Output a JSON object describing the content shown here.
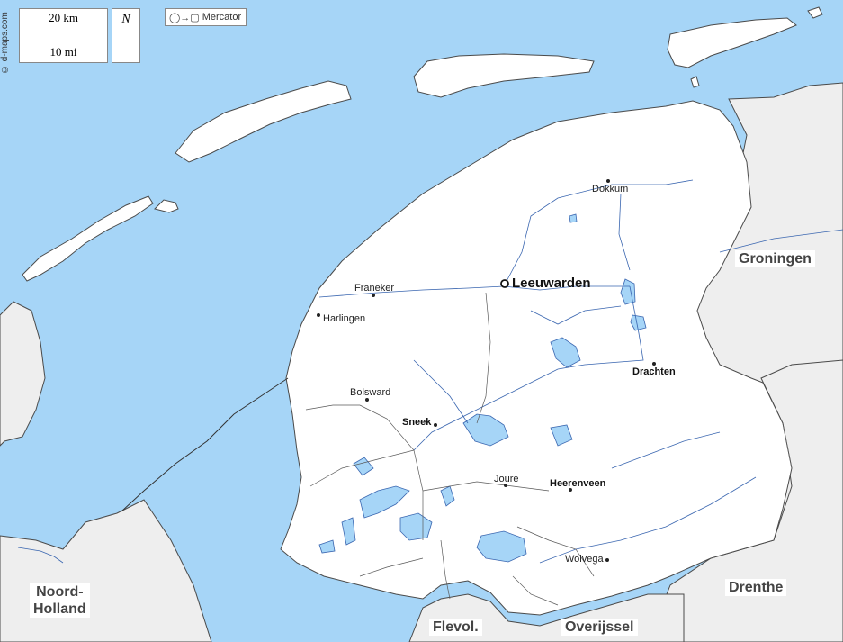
{
  "map": {
    "credit": "© d-maps.com",
    "projection": "Mercator",
    "projection_symbol": "◯→▢",
    "north": "N",
    "scale": {
      "km": "20 km",
      "mi": "10 mi"
    },
    "colors": {
      "water": "#a6d5f7",
      "land": "#ffffff",
      "neighbor": "#eeeeee",
      "border": "#4a4a4a",
      "river": "#3a66b0"
    },
    "capital": {
      "name": "Leeuwarden",
      "icon": "capital-circle-icon"
    },
    "cities": [
      {
        "id": "dokkum",
        "name": "Dokkum",
        "bold": false
      },
      {
        "id": "franeker",
        "name": "Franeker",
        "bold": false
      },
      {
        "id": "harlingen",
        "name": "Harlingen",
        "bold": false
      },
      {
        "id": "drachten",
        "name": "Drachten",
        "bold": true
      },
      {
        "id": "bolsward",
        "name": "Bolsward",
        "bold": false
      },
      {
        "id": "sneek",
        "name": "Sneek",
        "bold": true
      },
      {
        "id": "joure",
        "name": "Joure",
        "bold": false
      },
      {
        "id": "heerenveen",
        "name": "Heerenveen",
        "bold": true
      },
      {
        "id": "wolvega",
        "name": "Wolvega",
        "bold": false
      }
    ],
    "regions": {
      "groningen": "Groningen",
      "noord_holland_1": "Noord-",
      "noord_holland_2": "Holland",
      "drenthe": "Drenthe",
      "flevoland": "Flevol.",
      "overijssel": "Overijssel"
    }
  }
}
